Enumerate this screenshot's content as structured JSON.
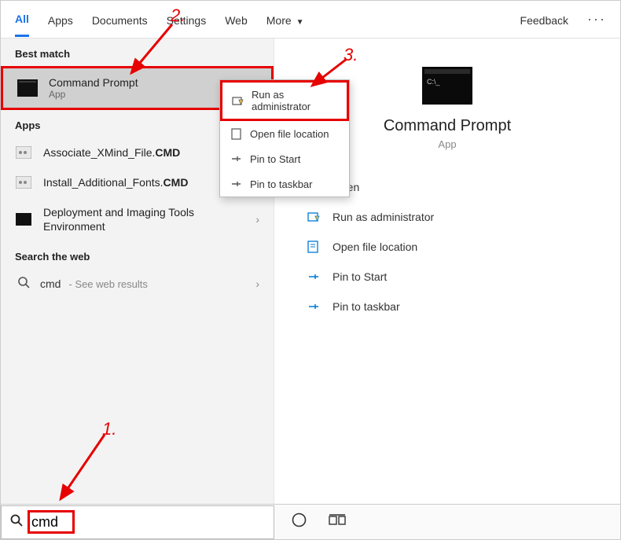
{
  "tabs": {
    "all": "All",
    "apps": "Apps",
    "documents": "Documents",
    "settings": "Settings",
    "web": "Web",
    "more": "More",
    "feedback": "Feedback"
  },
  "sections": {
    "best_match": "Best match",
    "apps": "Apps",
    "search_web": "Search the web"
  },
  "best_match": {
    "title": "Command Prompt",
    "subtitle": "App"
  },
  "apps_list": [
    {
      "name_parts": [
        "Associate_XMind_File.",
        "CMD"
      ]
    },
    {
      "name_parts": [
        "Install_Additional_Fonts.",
        "CMD"
      ]
    },
    {
      "name_parts": [
        "Deployment and Imaging Tools Environment",
        ""
      ]
    }
  ],
  "web_result": {
    "query": "cmd",
    "hint": "- See web results"
  },
  "preview": {
    "title": "Command Prompt",
    "subtitle": "App"
  },
  "actions": {
    "open": "Open",
    "run_admin": "Run as administrator",
    "open_loc": "Open file location",
    "pin_start": "Pin to Start",
    "pin_taskbar": "Pin to taskbar"
  },
  "context_menu": {
    "run_admin": "Run as administrator",
    "open_loc": "Open file location",
    "pin_start": "Pin to Start",
    "pin_taskbar": "Pin to taskbar"
  },
  "search": {
    "value": "cmd"
  },
  "annotations": {
    "n1": "1.",
    "n2": "2.",
    "n3": "3."
  }
}
